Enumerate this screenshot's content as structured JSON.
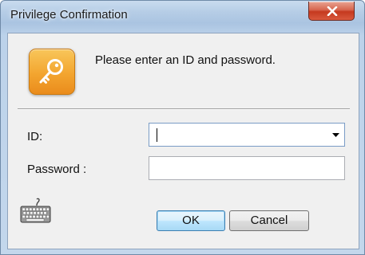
{
  "window": {
    "title": "Privilege Confirmation"
  },
  "dialog": {
    "prompt": "Please enter an ID and password.",
    "id_label": "ID:",
    "id_value": "",
    "password_label": "Password :",
    "password_value": "",
    "ok_label": "OK",
    "cancel_label": "Cancel"
  },
  "icons": {
    "app": "key-icon",
    "close": "close-icon",
    "dropdown": "chevron-down-icon",
    "keyboard": "keyboard-icon"
  },
  "colors": {
    "key_icon_bg": "#f3a52f",
    "close_button": "#c5391f",
    "default_button_border": "#3c7fb1"
  }
}
